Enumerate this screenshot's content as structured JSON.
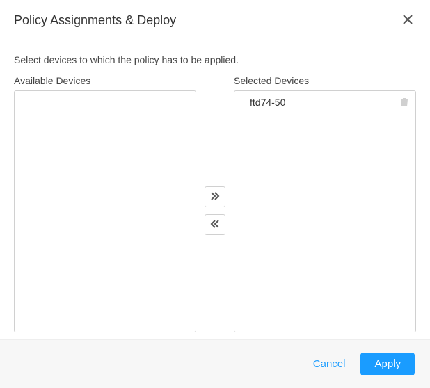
{
  "header": {
    "title": "Policy Assignments & Deploy"
  },
  "body": {
    "instruction": "Select devices to which the policy has to be applied.",
    "available_label": "Available Devices",
    "selected_label": "Selected Devices",
    "available_devices": [],
    "selected_devices": [
      {
        "name": "ftd74-50"
      }
    ]
  },
  "footer": {
    "cancel_label": "Cancel",
    "apply_label": "Apply"
  }
}
